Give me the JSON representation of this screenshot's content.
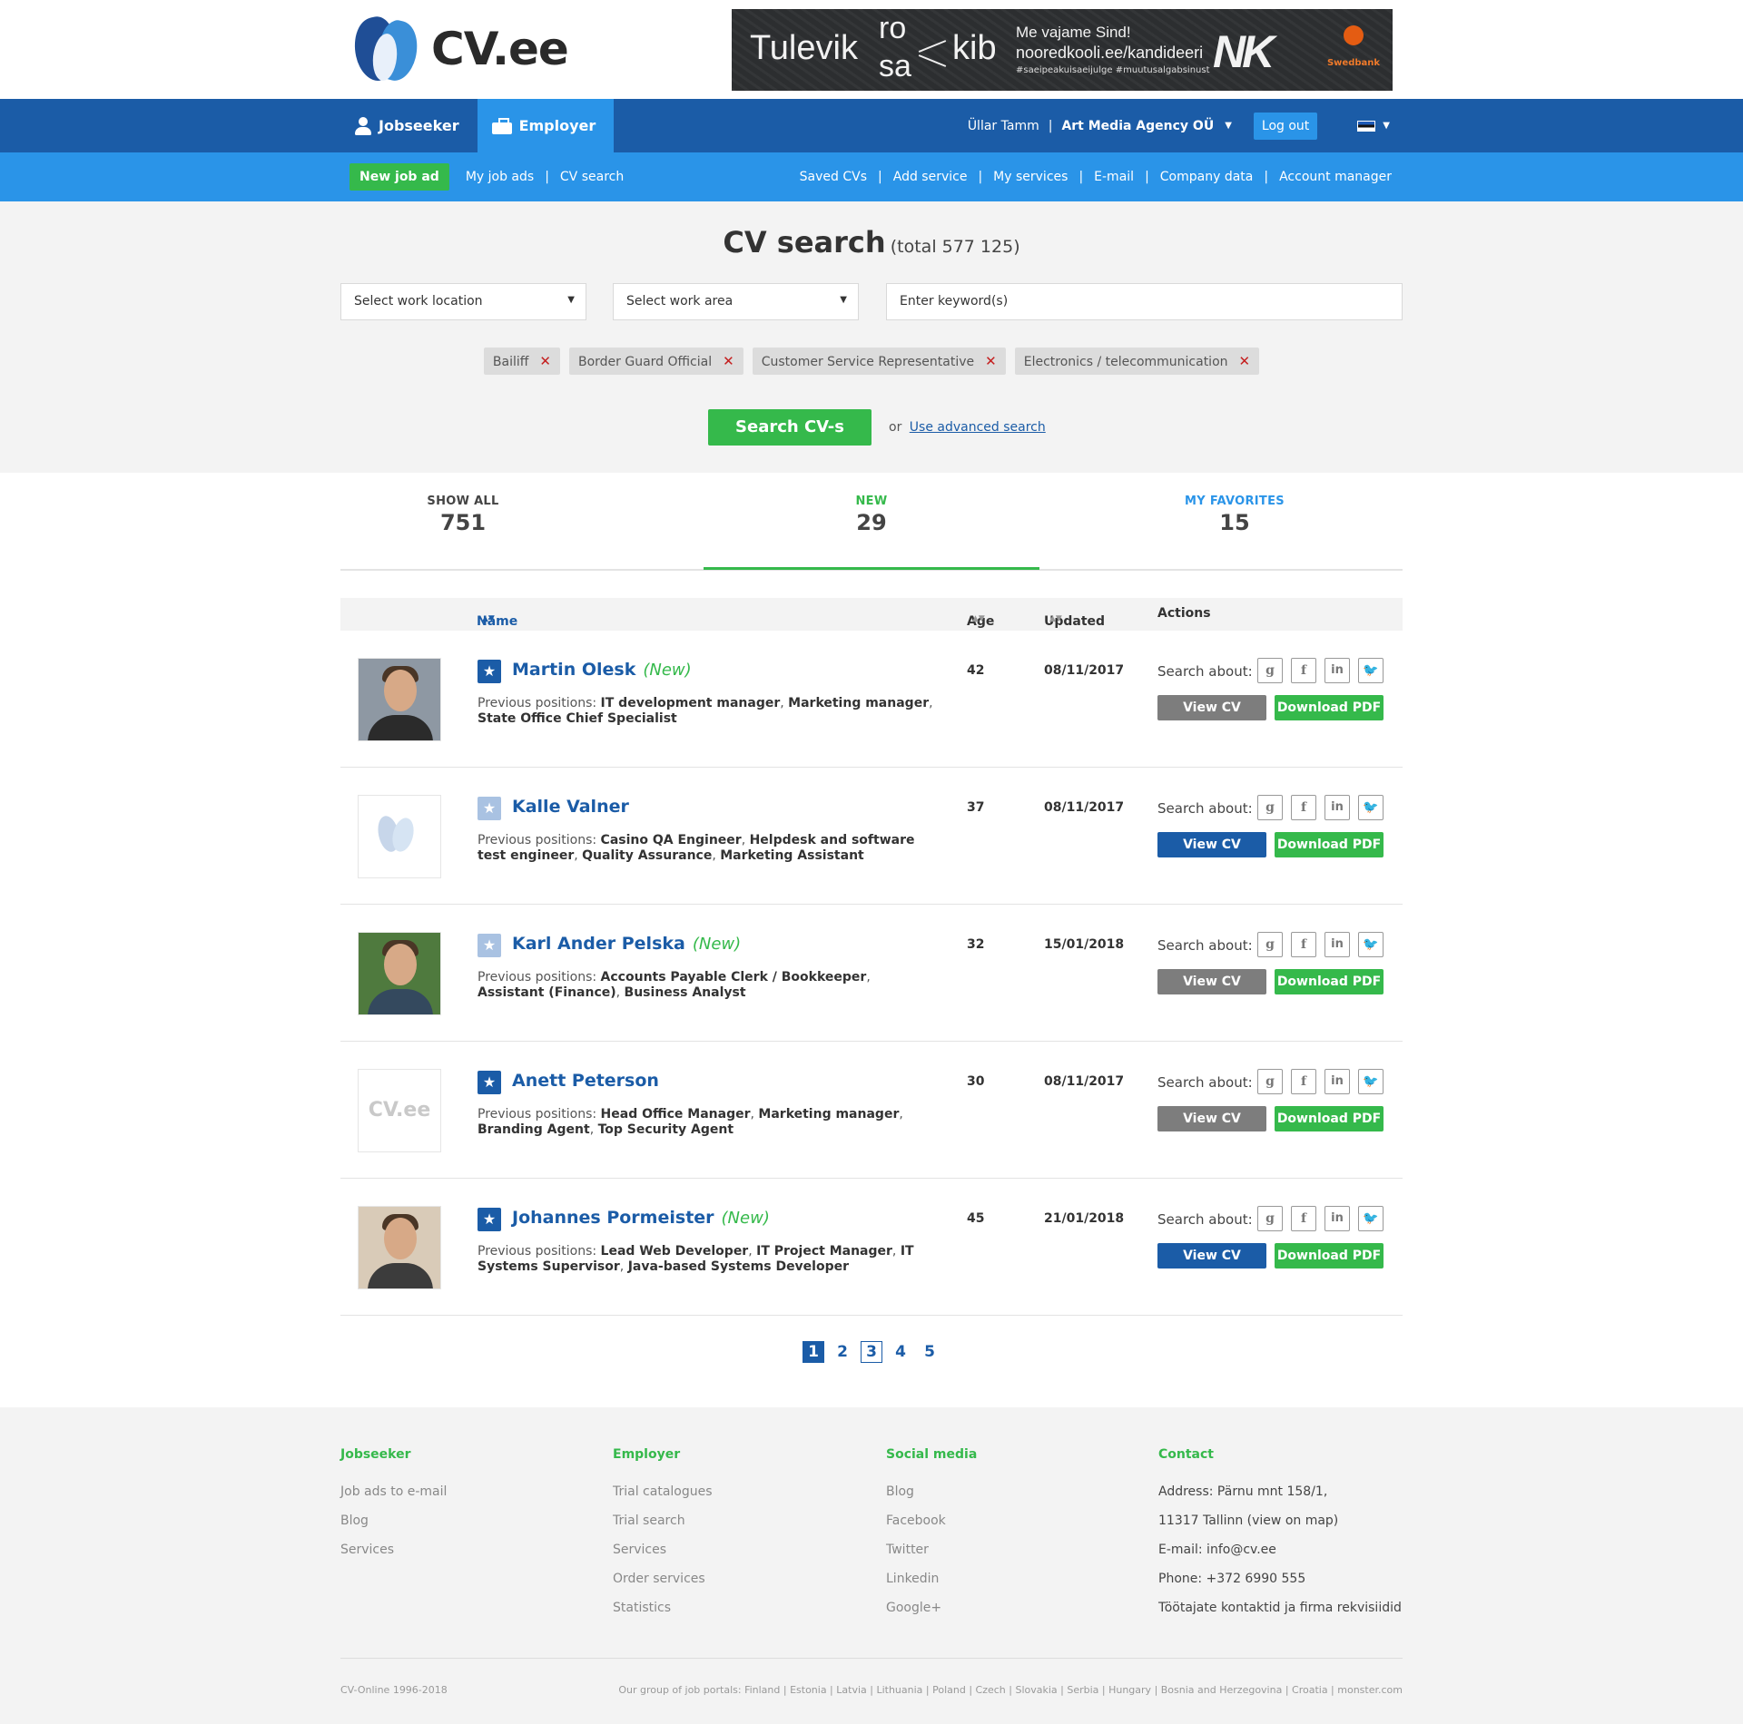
{
  "brand": {
    "logo_text": "CV.ee"
  },
  "banner": {
    "word1": "Tulevik",
    "word_top": "ro",
    "word_bottom": "sa",
    "word2": "kib",
    "line1": "Me vajame Sind!",
    "line2": "nooredkooli.ee/kandideeri",
    "hashtags": "#saeipeakuisaeijulge   #muutusalgabsinust",
    "mark": "NK",
    "sponsor": "Swedbank"
  },
  "topnav": {
    "jobseeker": "Jobseeker",
    "employer": "Employer",
    "user": "Üllar Tamm",
    "separator": "|",
    "company": "Art Media Agency OÜ",
    "logout": "Log out"
  },
  "subnav": {
    "new_job_ad": "New job ad",
    "my_job_ads": "My job ads",
    "cv_search": "CV search",
    "right": [
      "Saved CVs",
      "Add service",
      "My services",
      "E-mail",
      "Company data",
      "Account manager"
    ]
  },
  "search": {
    "title": "CV search",
    "total": "(total 577 125)",
    "location_placeholder": "Select work location",
    "area_placeholder": "Select work area",
    "keyword_placeholder": "Enter keyword(s)",
    "tags": [
      "Bailiff",
      "Border Guard Official",
      "Customer Service Representative",
      "Electronics / telecommunication"
    ],
    "button": "Search CV-s",
    "or": "or",
    "advanced": "Use advanced search"
  },
  "tabs": [
    {
      "label": "SHOW ALL",
      "count": "751"
    },
    {
      "label": "NEW",
      "count": "29"
    },
    {
      "label": "MY FAVORITES",
      "count": "15"
    }
  ],
  "table": {
    "headers": {
      "name": "Name",
      "age": "Age",
      "updated": "Updated",
      "actions": "Actions"
    },
    "search_about": "Search about:",
    "prev_label": "Previous positions:",
    "view_cv": "View CV",
    "download_pdf": "Download PDF",
    "new_label": "(New)",
    "rows": [
      {
        "name": "Martin Olesk",
        "is_new": true,
        "age": "42",
        "updated": "08/11/2017",
        "positions": [
          "IT development manager",
          "Marketing manager",
          "State Office Chief Specialist"
        ],
        "favorite": true,
        "view_style": "gray",
        "photo": "face"
      },
      {
        "name": "Kalle Valner",
        "is_new": false,
        "age": "37",
        "updated": "08/11/2017",
        "positions": [
          "Casino QA Engineer",
          "Helpdesk and software test engineer",
          "Quality Assurance",
          "Marketing Assistant"
        ],
        "favorite": false,
        "view_style": "blue",
        "photo": "logo"
      },
      {
        "name": "Karl Ander Pelska",
        "is_new": true,
        "age": "32",
        "updated": "15/01/2018",
        "positions": [
          "Accounts Payable Clerk / Bookkeeper",
          "Assistant (Finance)",
          "Business Analyst"
        ],
        "favorite": false,
        "view_style": "gray",
        "photo": "face"
      },
      {
        "name": "Anett Peterson",
        "is_new": false,
        "age": "30",
        "updated": "08/11/2017",
        "positions": [
          "Head Office Manager",
          "Marketing manager",
          "Branding Agent",
          "Top Security Agent"
        ],
        "favorite": true,
        "view_style": "gray",
        "photo": "cvee"
      },
      {
        "name": "Johannes Pormeister",
        "is_new": true,
        "age": "45",
        "updated": "21/01/2018",
        "positions": [
          "Lead Web Developer",
          "IT Project Manager",
          "IT Systems Supervisor",
          "Java-based Systems Developer"
        ],
        "favorite": true,
        "view_style": "blue",
        "photo": "face"
      }
    ]
  },
  "pagination": [
    "1",
    "2",
    "3",
    "4",
    "5"
  ],
  "footer": {
    "jobseeker": {
      "title": "Jobseeker",
      "links": [
        "Job ads to e-mail",
        "Blog",
        "Services"
      ]
    },
    "employer": {
      "title": "Employer",
      "links": [
        "Trial catalogues",
        "Trial search",
        "Services",
        "Order services",
        "Statistics"
      ]
    },
    "social": {
      "title": "Social media",
      "links": [
        "Blog",
        "Facebook",
        "Twitter",
        "Linkedin",
        "Google+"
      ]
    },
    "contact": {
      "title": "Contact",
      "lines": [
        "Address: Pärnu mnt 158/1,",
        "11317 Tallinn (view on map)",
        "E-mail: info@cv.ee",
        "Phone: +372 6990 555",
        "Töötajate kontaktid ja firma rekvisiidid"
      ]
    },
    "copyright": "CV-Online 1996-2018",
    "group": "Our group of job portals: Finland | Estonia | Latvia | Lithuania | Poland | Czech | Slovakia | Serbia | Hungary | Bosnia and Herzegovina | Croatia | monster.com"
  },
  "colors": {
    "primary": "#1b5ca7",
    "accent": "#2a94e8",
    "green": "#35b94b"
  }
}
